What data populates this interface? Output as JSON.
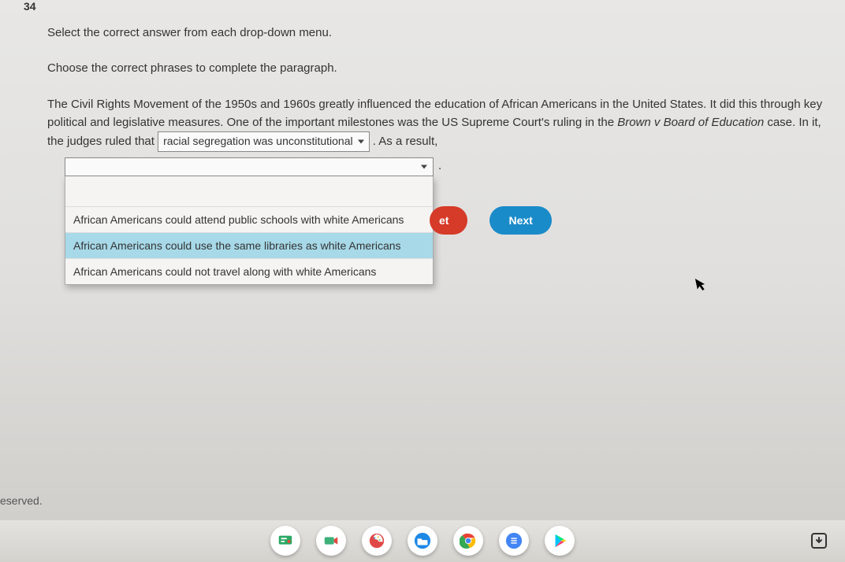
{
  "question_number": "34",
  "instruction1": "Select the correct answer from each drop-down menu.",
  "instruction2": "Choose the correct phrases to complete the paragraph.",
  "para": {
    "p1": "The Civil Rights Movement of the 1950s and 1960s greatly influenced the education of African Americans in the United States. It did this through key political and legislative measures. One of the important milestones was the US Supreme Court's ruling in the ",
    "case_name": "Brown v Board of Education",
    "p2": " case. In it, the judges ruled that ",
    "select1_value": "racial segregation was unconstitutional",
    "p3": " . As a result,"
  },
  "after_dd_punct": ".",
  "dropdown2": {
    "options": [
      "African Americans could attend public schools with white Americans",
      "African Americans could use the same libraries as white Americans",
      "African Americans could not travel along with white Americans"
    ],
    "highlighted_index": 1
  },
  "buttons": {
    "reset_visible_fragment": "et",
    "next": "Next"
  },
  "footer": "eserved.",
  "colors": {
    "reset_bg": "#d63a28",
    "next_bg": "#1a8bc9",
    "highlight_bg": "#a7d9e8"
  },
  "shelf_icons": [
    "presentation-app-icon",
    "camera-app-icon",
    "paint-app-icon",
    "files-app-icon",
    "chrome-icon",
    "docs-icon",
    "play-store-icon"
  ],
  "tray_icon": "screenshot-tray-icon"
}
